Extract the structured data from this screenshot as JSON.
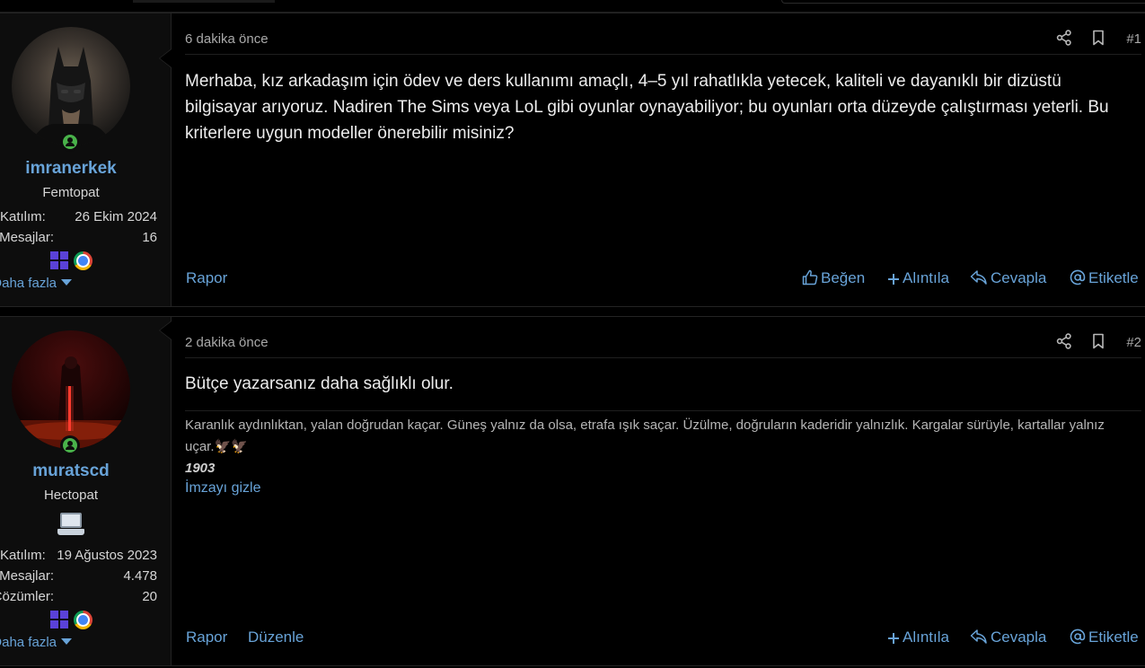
{
  "posts": [
    {
      "time": "6 dakika önce",
      "number": "#1",
      "user": {
        "name": "imranerkek",
        "title": "Femtopat",
        "stats": [
          {
            "label": "Katılım:",
            "value": "26 Ekim 2024"
          },
          {
            "label": "Mesajlar:",
            "value": "16"
          }
        ],
        "more": "Daha fazla"
      },
      "message": "Merhaba, kız arkadaşım için ödev ve ders kullanımı amaçlı, 4–5 yıl rahatlıkla yetecek, kaliteli ve dayanıklı bir dizüstü bilgisayar arıyoruz. Nadiren The Sims veya LoL gibi oyunlar oynayabiliyor; bu oyunları orta düzeyde çalıştırması yeterli. Bu kriterlere uygun modeller önerebilir misiniz?",
      "actions": {
        "report": "Rapor",
        "like": "Beğen",
        "quote": "Alıntıla",
        "reply": "Cevapla",
        "tag": "Etiketle"
      }
    },
    {
      "time": "2 dakika önce",
      "number": "#2",
      "user": {
        "name": "muratscd",
        "title": "Hectopat",
        "stats": [
          {
            "label": "Katılım:",
            "value": "19 Ağustos 2023"
          },
          {
            "label": "Mesajlar:",
            "value": "4.478"
          },
          {
            "label": "Çözümler:",
            "value": "20"
          }
        ],
        "more": "Daha fazla"
      },
      "message": "Bütçe yazarsanız daha sağlıklı olur.",
      "signature": "Karanlık aydınlıktan, yalan doğrudan kaçar. Güneş yalnız da olsa, etrafa ışık saçar. Üzülme, doğruların kaderidir yalnızlık. Kargalar sürüyle, kartallar yalnız uçar.🦅🦅",
      "signature_name": "1903",
      "hide_signature": "İmzayı gizle",
      "actions": {
        "report": "Rapor",
        "edit": "Düzenle",
        "quote": "Alıntıla",
        "reply": "Cevapla",
        "tag": "Etiketle"
      }
    }
  ],
  "colors": {
    "accent": "#68a3d8",
    "online": "#49b24a",
    "background": "#000000",
    "sidebar": "#0d0d0d"
  },
  "icons": [
    "share-icon",
    "bookmark-icon",
    "like-icon",
    "plus-icon",
    "reply-icon",
    "at-icon",
    "windows-icon",
    "chrome-icon",
    "laptop-icon",
    "caret-down-icon",
    "online-status-icon"
  ]
}
